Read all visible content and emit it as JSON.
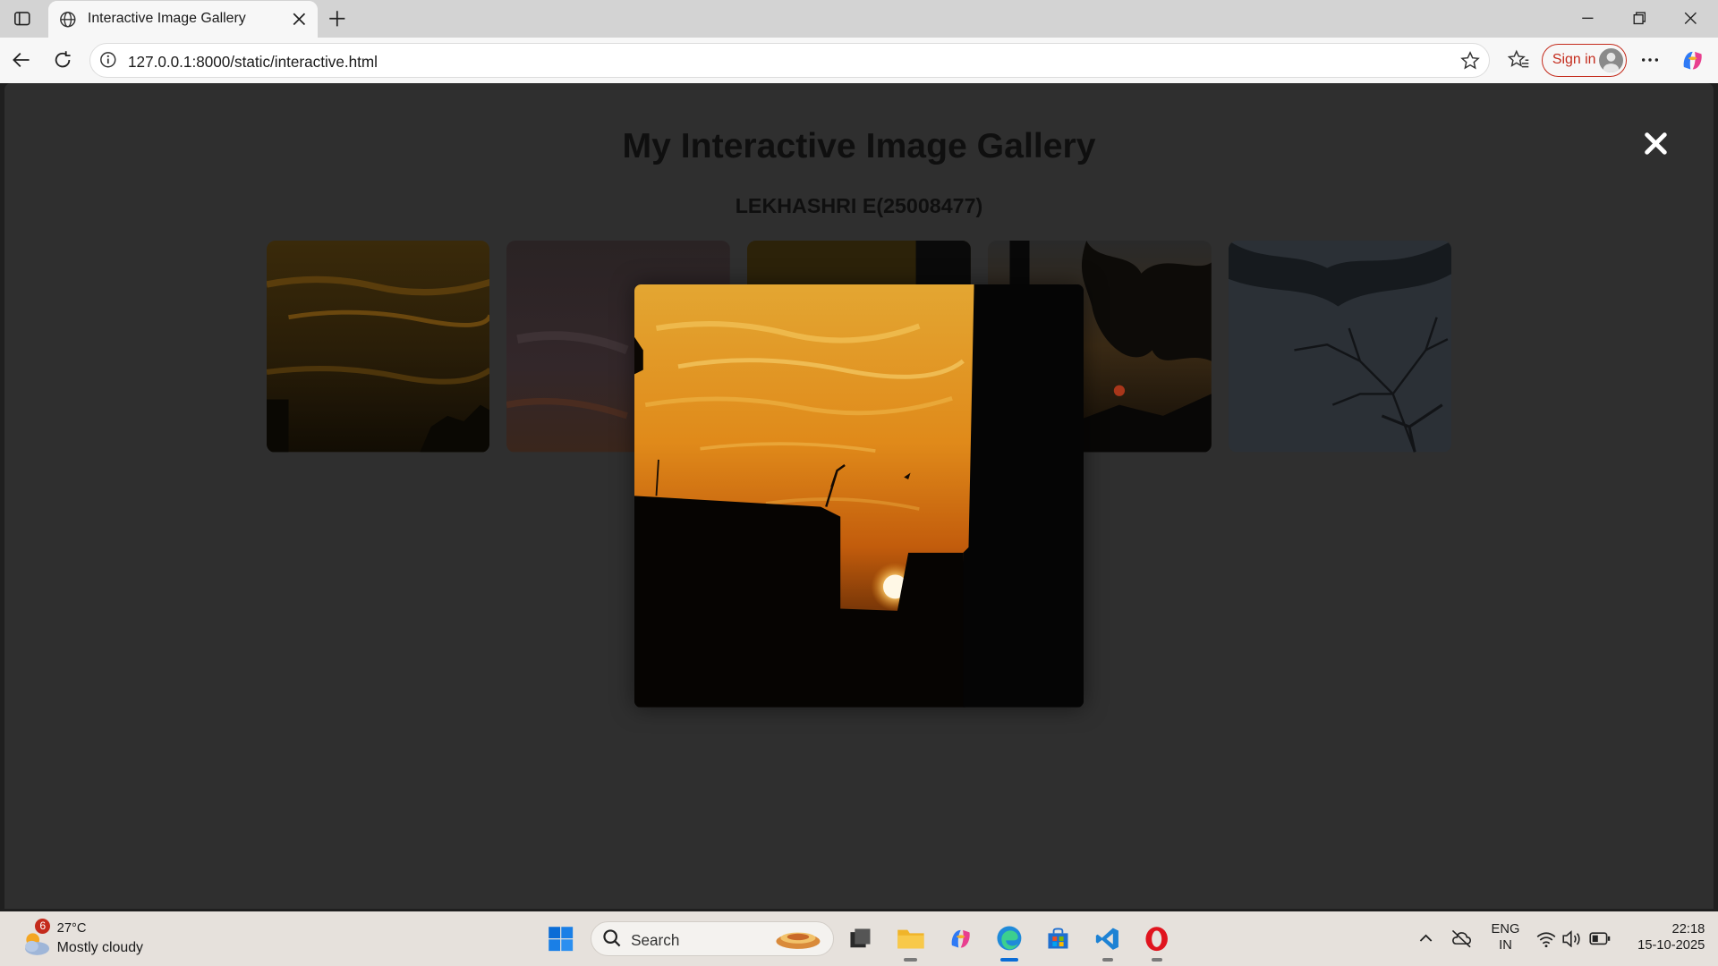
{
  "browser": {
    "tab_title": "Interactive Image Gallery",
    "url": "127.0.0.1:8000/static/interactive.html",
    "sign_in_label": "Sign in"
  },
  "page": {
    "title": "My Interactive Image Gallery",
    "subtitle": "LEKHASHRI E(25008477)",
    "thumbnails": [
      {
        "name": "orange cloudy sunset"
      },
      {
        "name": "dusk clouds"
      },
      {
        "name": "sunset building silhouette"
      },
      {
        "name": "sunset through trees"
      },
      {
        "name": "bare branches against grey sky"
      }
    ],
    "lightbox": {
      "open": true,
      "image": "sunset between buildings"
    }
  },
  "taskbar": {
    "weather_badge": "6",
    "temperature": "27°C",
    "condition": "Mostly cloudy",
    "search_placeholder": "Search",
    "language": "ENG",
    "region": "IN",
    "time": "22:18",
    "date": "15-10-2025"
  },
  "colors": {
    "page_bg": "#2f2f2f",
    "accent_red": "#c42b1c",
    "sunset_orange": "#e08a1a"
  }
}
